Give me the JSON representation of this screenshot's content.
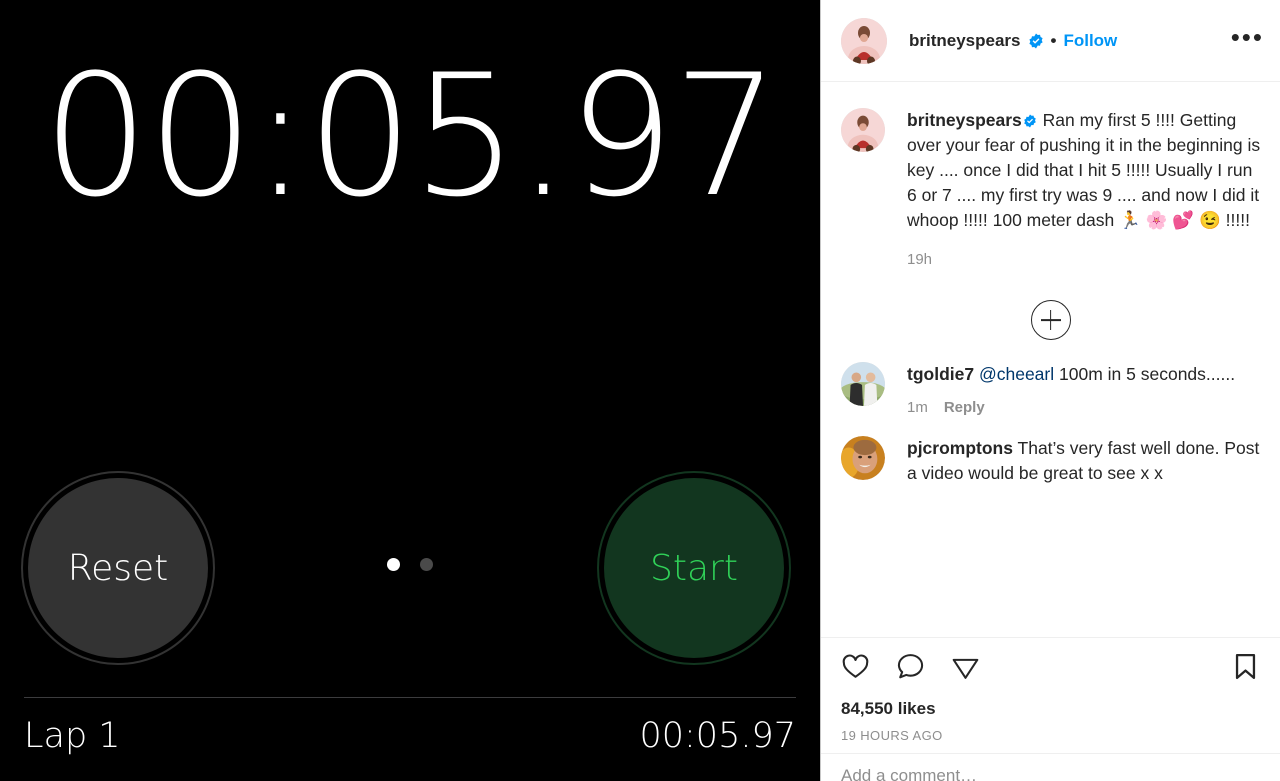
{
  "stopwatch": {
    "time": "00:05.97",
    "reset_label": "Reset",
    "start_label": "Start",
    "lap_label": "Lap 1",
    "lap_time": "00:05.97",
    "page_dots": 2,
    "active_dot": 1,
    "colors": {
      "background": "#000000",
      "reset_bg": "#333333",
      "start_bg": "#12361f",
      "start_text": "#30d158",
      "time_text": "#ffffff"
    }
  },
  "instagram": {
    "header": {
      "username": "britneyspears",
      "verified": true,
      "separator": "•",
      "follow_label": "Follow",
      "more_icon": "•••"
    },
    "caption": {
      "username": "britneyspears",
      "verified": true,
      "text": "Ran my first 5 !!!! Getting over your fear of pushing it in the beginning is key .... once I did that I hit 5 !!!!! Usually I run 6 or 7 .... my first try was 9 .... and now I did it whoop !!!!! 100 meter dash 🏃 🌸 💕 😉 !!!!!",
      "timestamp": "19h"
    },
    "load_more_icon": "plus-circle-icon",
    "comments": [
      {
        "username": "tgoldie7",
        "mention": "@cheearl",
        "text": "100m in 5 seconds......",
        "time": "1m",
        "reply_label": "Reply"
      },
      {
        "username": "pjcromptons",
        "mention": "",
        "text": "That’s very fast well done. Post a video would be great to see x x",
        "time": "",
        "reply_label": ""
      }
    ],
    "actions": {
      "like_icon": "heart-icon",
      "comment_icon": "speech-bubble-icon",
      "share_icon": "paper-plane-icon",
      "save_icon": "bookmark-icon",
      "likes": "84,550 likes",
      "posted": "19 HOURS AGO"
    },
    "add_comment_placeholder": "Add a comment…",
    "colors": {
      "link": "#0095f6",
      "mention": "#00376b",
      "text": "#262626",
      "muted": "#8e8e8e",
      "background": "#ffffff"
    }
  }
}
